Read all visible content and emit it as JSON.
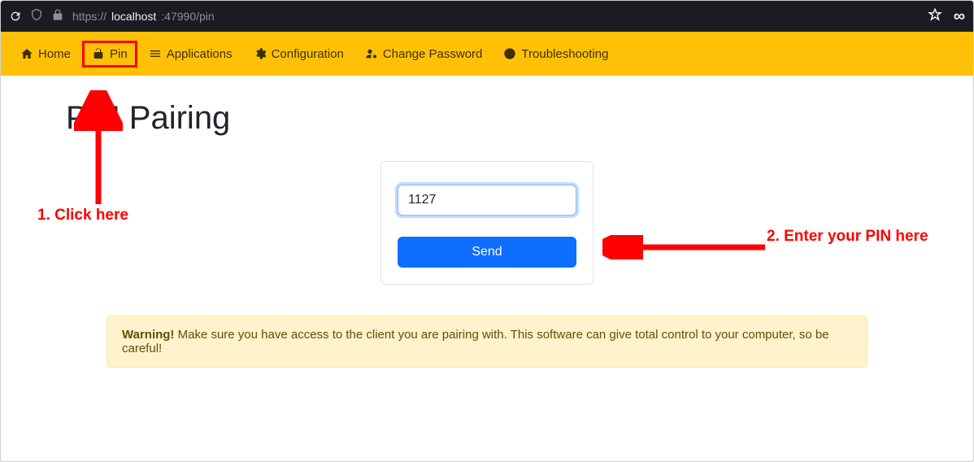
{
  "browser": {
    "url_proto": "https://",
    "url_host": "localhost",
    "url_rest": ":47990/pin"
  },
  "nav": {
    "home": "Home",
    "pin": "Pin",
    "applications": "Applications",
    "configuration": "Configuration",
    "change_password": "Change Password",
    "troubleshooting": "Troubleshooting"
  },
  "page": {
    "title": "PIN Pairing",
    "pin_value": "1127",
    "send_label": "Send"
  },
  "alert": {
    "strong": "Warning!",
    "text": " Make sure you have access to the client you are pairing with. This software can give total control to your computer, so be careful!"
  },
  "annotations": {
    "step1": "1. Click here",
    "step2": "2. Enter your PIN here"
  }
}
